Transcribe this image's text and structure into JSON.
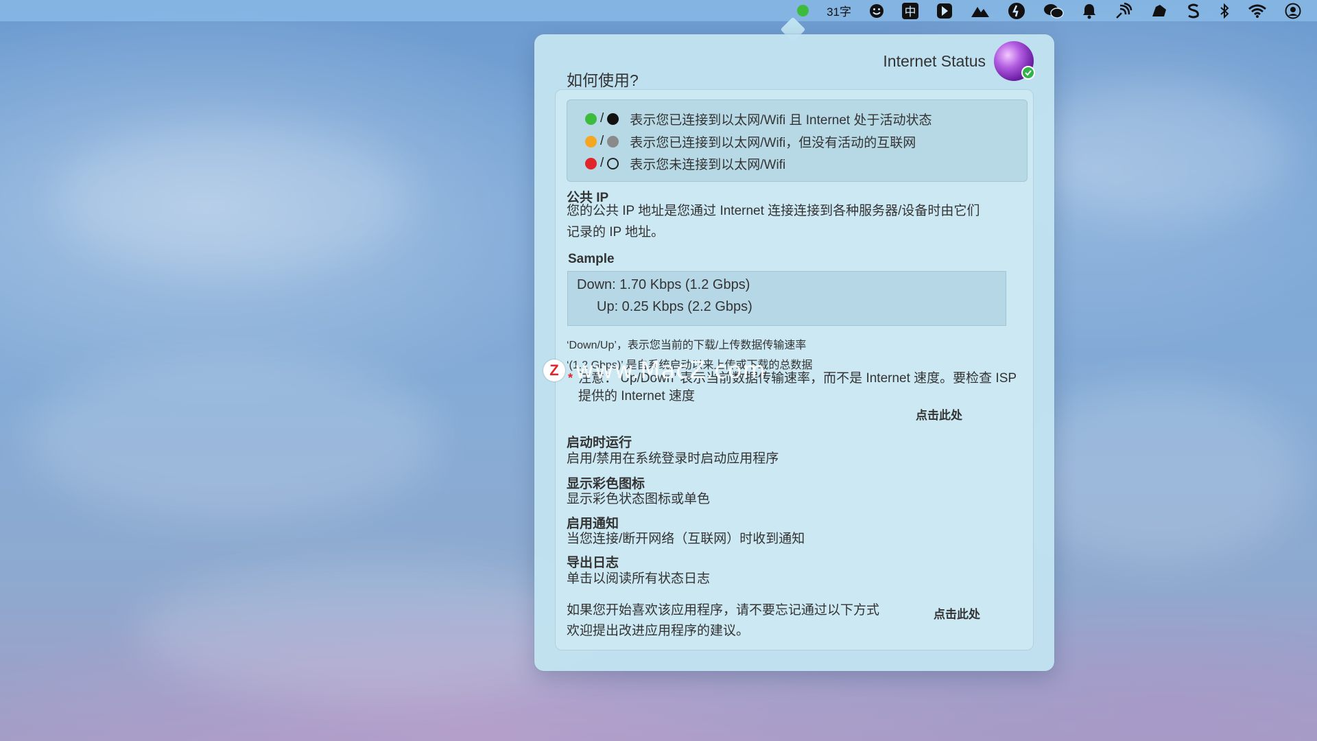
{
  "menubar": {
    "word_count": "31字",
    "input_method": "中"
  },
  "popover": {
    "app_title": "Internet Status",
    "howto_title": "如何使用?",
    "legend": [
      {
        "color_a": "#3cbb3c",
        "color_b": "#111111",
        "hollow_b": false,
        "text": "表示您已连接到以太网/Wifi 且 Internet 处于活动状态"
      },
      {
        "color_a": "#f5a623",
        "color_b": "#8a8a8a",
        "hollow_b": false,
        "text": "表示您已连接到以太网/Wifi，但没有活动的互联网"
      },
      {
        "color_a": "#e0262a",
        "color_b": "transparent",
        "hollow_b": true,
        "text": "表示您未连接到以太网/Wifi"
      }
    ],
    "legend_separator": "/",
    "public_ip": {
      "title": "公共 IP",
      "line1": "您的公共 IP 地址是您通过 Internet 连接连接到各种服务器/设备时由它们",
      "line2": "记录的 IP 地址。"
    },
    "sample": {
      "title": "Sample",
      "down": "Down:  1.70 Kbps (1.2 Gbps)",
      "up": "Up:   0.25 Kbps (2.2 Gbps)"
    },
    "notes": {
      "line1": "‘Down/Up’，表示您当前的下载/上传数据传输速率",
      "line2": "‘(1.2 Gbps)’ 是自系统启动以来上传或下载的总数据",
      "star": "*",
      "warning": "注意：‘Up/Down’ 表示当前数据传输速率，而不是 Internet 速度。要检查 ISP 提供的 Internet 速度",
      "link": "点击此处"
    },
    "sections": [
      {
        "title": "启动时运行",
        "text": "启用/禁用在系统登录时启动应用程序"
      },
      {
        "title": "显示彩色图标",
        "text": "显示彩色状态图标或单色"
      },
      {
        "title": "启用通知",
        "text": "当您连接/断开网络（互联网）时收到通知"
      },
      {
        "title": "导出日志",
        "text": "单击以阅读所有状态日志"
      }
    ],
    "feedback": {
      "line1": "如果您开始喜欢该应用程序，请不要忘记通过以下方式",
      "line2": "欢迎提出改进应用程序的建议。",
      "link": "点击此处"
    }
  },
  "watermark": {
    "logo_letter": "Z",
    "text": "www.MacZ.com"
  }
}
